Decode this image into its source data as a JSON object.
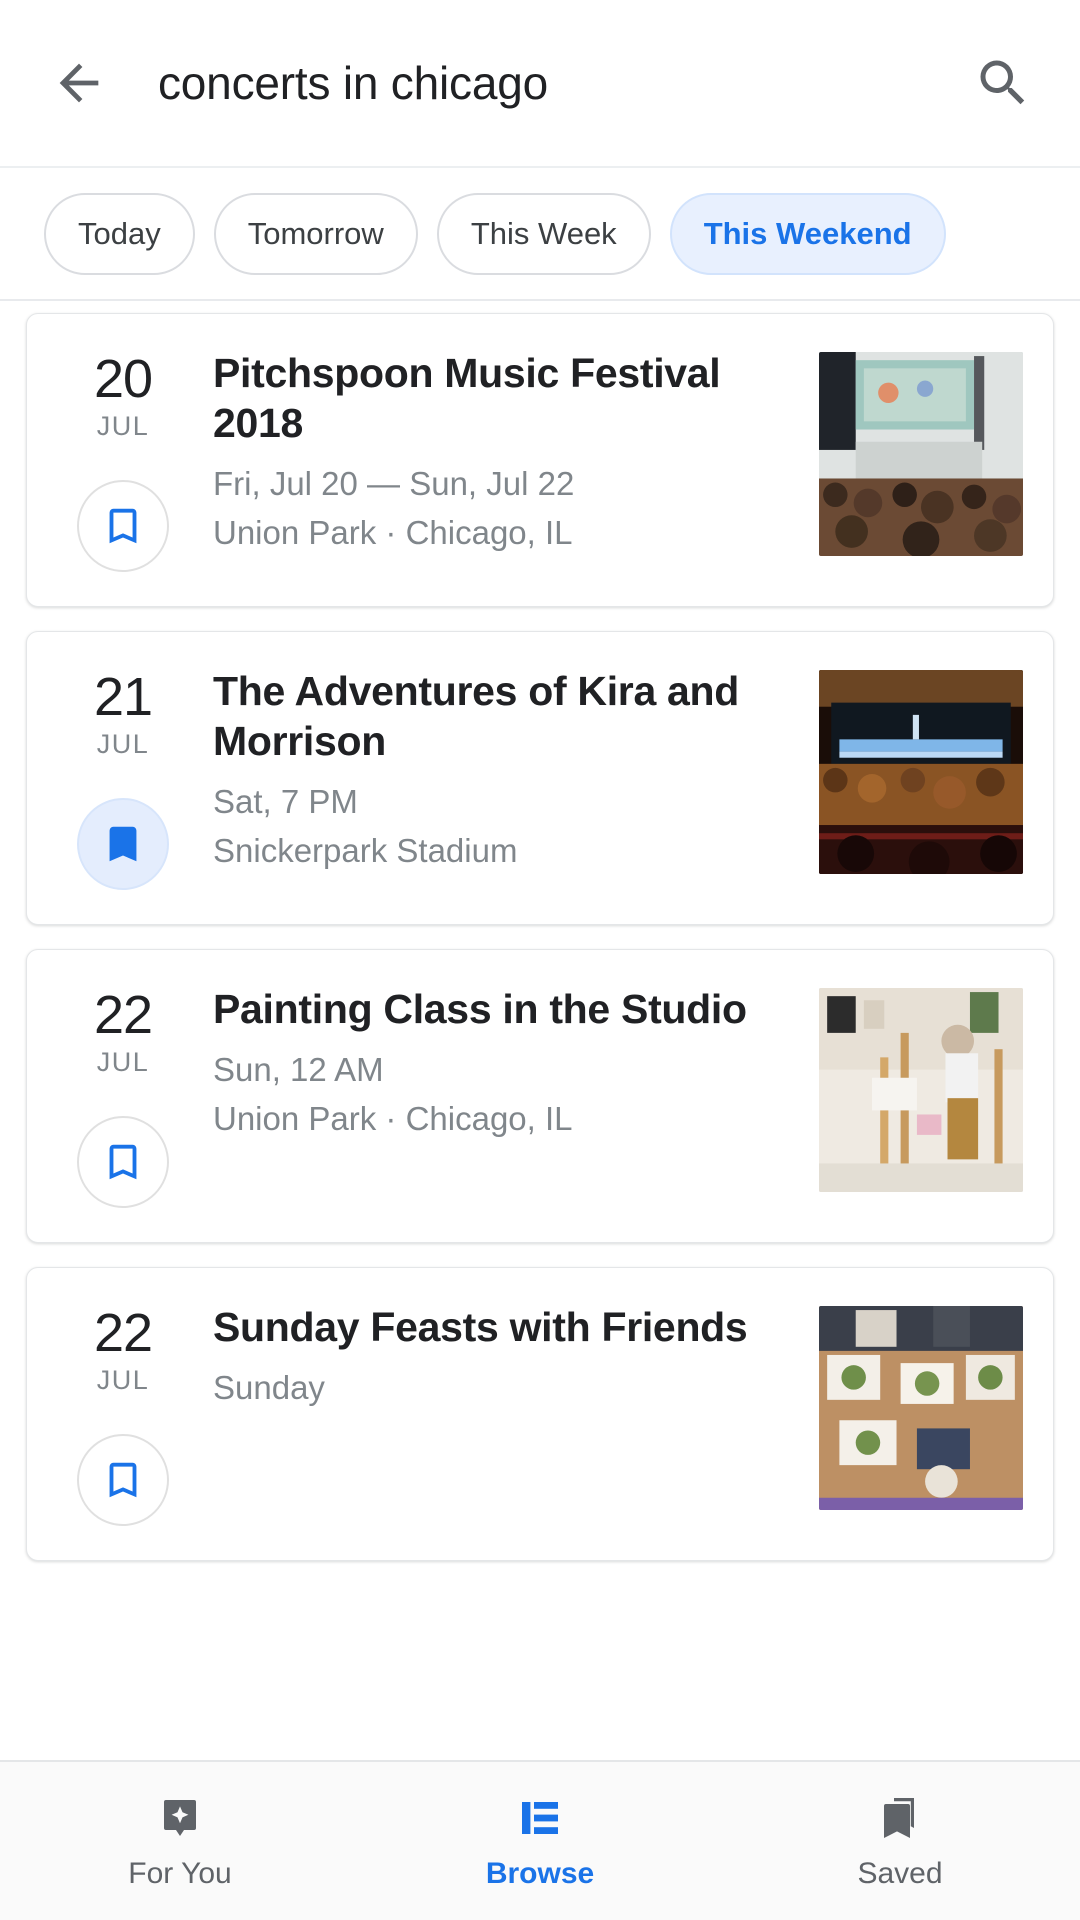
{
  "search": {
    "query": "concerts in chicago",
    "placeholder": "Search",
    "back_icon": "back-arrow-icon",
    "search_icon": "search-icon"
  },
  "filters": {
    "chips": [
      {
        "label": "Today",
        "selected": false
      },
      {
        "label": "Tomorrow",
        "selected": false
      },
      {
        "label": "This Week",
        "selected": false
      },
      {
        "label": "This Weekend",
        "selected": true
      }
    ]
  },
  "events": [
    {
      "day": "20",
      "month": "JUL",
      "title": "Pitchspoon Music Festival 2018",
      "time": "Fri, Jul 20 — Sun, Jul 22",
      "venue": "Union Park · Chicago, IL",
      "saved": false,
      "bookmark_icon": "bookmark-outline-icon",
      "thumb_alt": "festival-crowd-stage-photo"
    },
    {
      "day": "21",
      "month": "JUL",
      "title": "The Adventures of Kira and Morrison",
      "time": "Sat, 7 PM",
      "venue": "Snickerpark Stadium",
      "saved": true,
      "bookmark_icon": "bookmark-filled-icon",
      "thumb_alt": "theatre-audience-stage-photo"
    },
    {
      "day": "22",
      "month": "JUL",
      "title": "Painting Class in the Studio",
      "time": "Sun, 12 AM",
      "venue": "Union Park · Chicago, IL",
      "saved": false,
      "bookmark_icon": "bookmark-outline-icon",
      "thumb_alt": "painting-studio-easel-photo"
    },
    {
      "day": "22",
      "month": "JUL",
      "title": "Sunday Feasts with Friends",
      "time": "Sunday",
      "venue": "",
      "saved": false,
      "bookmark_icon": "bookmark-outline-icon",
      "thumb_alt": "dinner-table-food-photo"
    }
  ],
  "bottom_nav": {
    "items": [
      {
        "label": "For You",
        "icon": "sparkle-bookmark-icon",
        "active": false
      },
      {
        "label": "Browse",
        "icon": "list-icon",
        "active": true
      },
      {
        "label": "Saved",
        "icon": "saved-bookmarks-icon",
        "active": false
      }
    ]
  },
  "colors": {
    "accent": "#1a73e8",
    "chip_selected_bg": "#e8f0fe",
    "text_primary": "#202124",
    "text_secondary": "#80868b",
    "nav_inactive": "#5f6368"
  }
}
